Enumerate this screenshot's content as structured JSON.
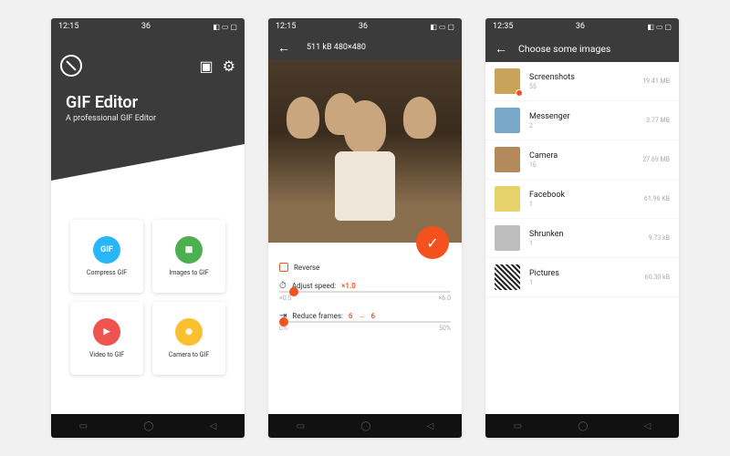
{
  "status": {
    "time1": "12:15",
    "time2": "12:15",
    "time3": "12:35",
    "net": "36"
  },
  "screen1": {
    "title": "GIF Editor",
    "subtitle": "A professional GIF Editor",
    "cards": {
      "compress": {
        "label": "Compress GIF",
        "badge": "GIF",
        "color": "#29b6f6"
      },
      "images": {
        "label": "Images to GIF",
        "color": "#4caf50"
      },
      "video": {
        "label": "Video to GIF",
        "color": "#ef5350"
      },
      "camera": {
        "label": "Camera to GIF",
        "color": "#fbc02d"
      }
    }
  },
  "screen2": {
    "file_info": "511 kB   480×480",
    "reverse_label": "Reverse",
    "speed": {
      "label": "Adjust speed:",
      "value": "×1.0",
      "min": "×0.5",
      "max": "×6.0",
      "thumb_pct": 6
    },
    "frames": {
      "label": "Reduce frames:",
      "from": "6",
      "arrow": "→",
      "to": "6",
      "min": "0%",
      "max": "50%",
      "thumb_pct": 0
    }
  },
  "screen3": {
    "title": "Choose some images",
    "folders": [
      {
        "name": "Screenshots",
        "count": "55",
        "size": "19.41 MB",
        "thumb": "#caa35a",
        "dot": true
      },
      {
        "name": "Messenger",
        "count": "2",
        "size": "3.77 MB",
        "thumb": "#7aa8c9"
      },
      {
        "name": "Camera",
        "count": "16",
        "size": "27.69 MB",
        "thumb": "#b48a5c"
      },
      {
        "name": "Facebook",
        "count": "1",
        "size": "61.96 KB",
        "thumb": "#e6d26a"
      },
      {
        "name": "Shrunken",
        "count": "1",
        "size": "9.73 kB",
        "thumb": "#bdbdbd"
      },
      {
        "name": "Pictures",
        "count": "1",
        "size": "60.30 kB",
        "thumb": "qr"
      }
    ]
  }
}
